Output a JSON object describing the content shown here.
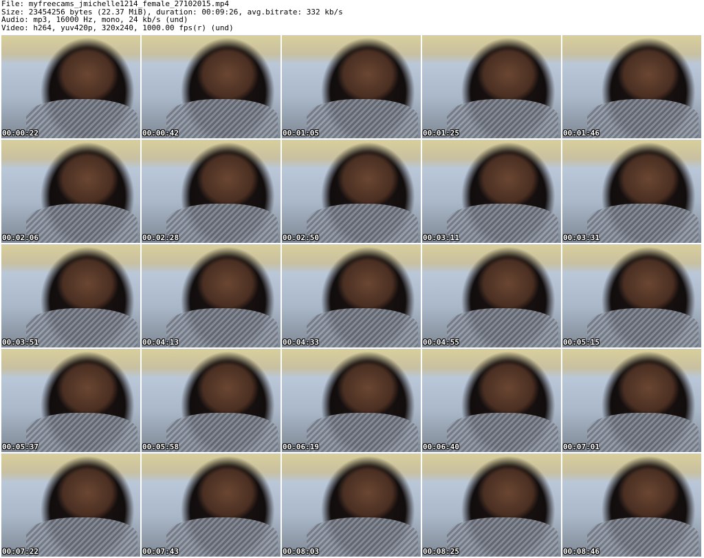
{
  "header": {
    "file_line": "File: myfreecams_jmichelle1214_female_27102015.mp4",
    "size_line": "Size: 23454256 bytes (22.37 MiB), duration: 00:09:26, avg.bitrate: 332 kb/s",
    "audio_line": "Audio: mp3, 16000 Hz, mono, 24 kb/s (und)",
    "video_line": "Video: h264, yuv420p, 320x240, 1000.00 fps(r) (und)"
  },
  "thumbnails": [
    {
      "timestamp": "00:00:22"
    },
    {
      "timestamp": "00:00:42"
    },
    {
      "timestamp": "00:01:05"
    },
    {
      "timestamp": "00:01:25"
    },
    {
      "timestamp": "00:01:46"
    },
    {
      "timestamp": "00:02:06"
    },
    {
      "timestamp": "00:02:28"
    },
    {
      "timestamp": "00:02:50"
    },
    {
      "timestamp": "00:03:11"
    },
    {
      "timestamp": "00:03:31"
    },
    {
      "timestamp": "00:03:51"
    },
    {
      "timestamp": "00:04:13"
    },
    {
      "timestamp": "00:04:33"
    },
    {
      "timestamp": "00:04:55"
    },
    {
      "timestamp": "00:05:15"
    },
    {
      "timestamp": "00:05:37"
    },
    {
      "timestamp": "00:05:58"
    },
    {
      "timestamp": "00:06:19"
    },
    {
      "timestamp": "00:06:40"
    },
    {
      "timestamp": "00:07:01"
    },
    {
      "timestamp": "00:07:22"
    },
    {
      "timestamp": "00:07:43"
    },
    {
      "timestamp": "00:08:03"
    },
    {
      "timestamp": "00:08:25"
    },
    {
      "timestamp": "00:08:46"
    }
  ]
}
